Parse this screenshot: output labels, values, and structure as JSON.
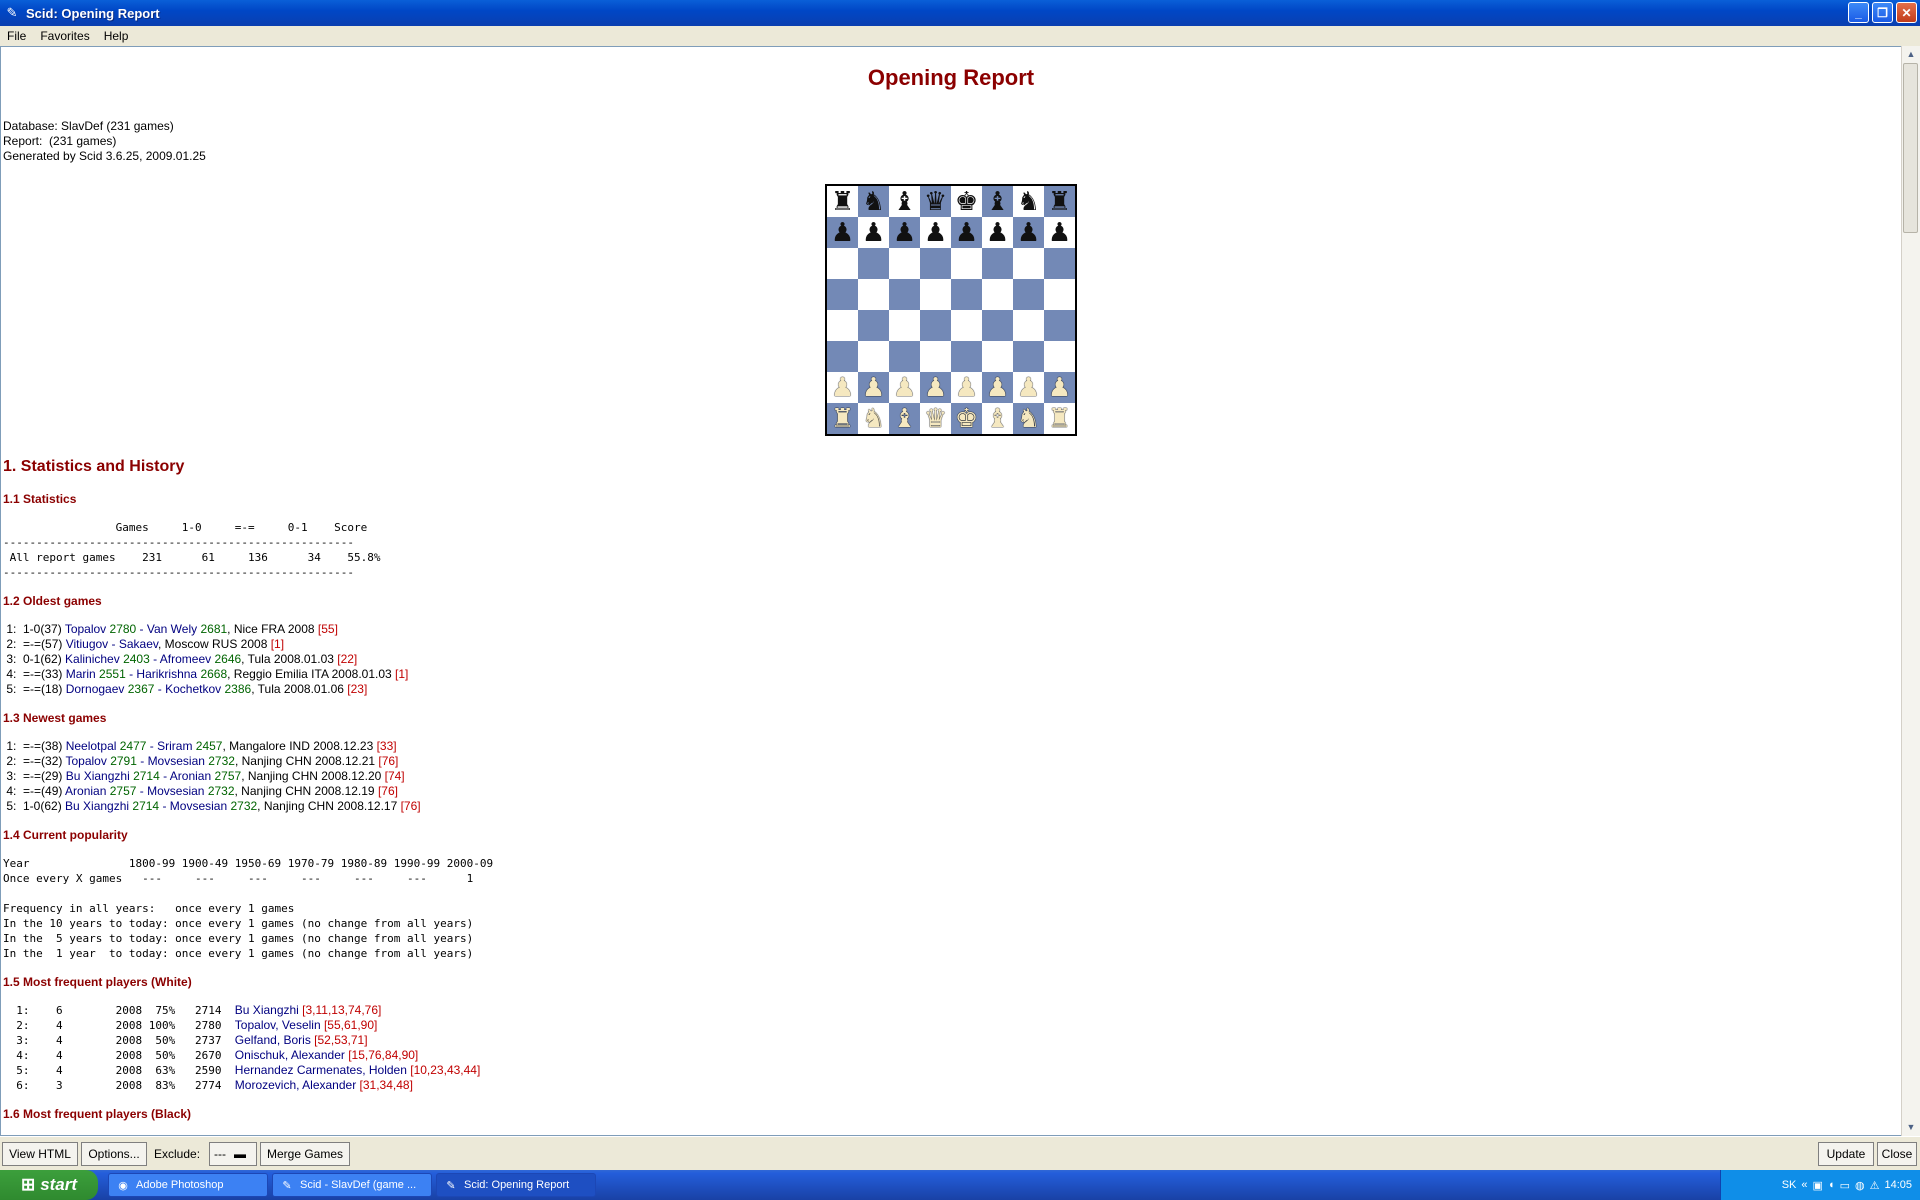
{
  "window": {
    "title": "Scid: Opening Report"
  },
  "menu": [
    "File",
    "Favorites",
    "Help"
  ],
  "report": {
    "title": "Opening Report",
    "meta": [
      "Database: SlavDef (231 games)",
      "Report:  (231 games)",
      "Generated by Scid 3.6.25, 2009.01.25"
    ],
    "board": [
      "rnbqkbnr",
      "pppppppp",
      "........",
      "........",
      "........",
      "........",
      "PPPPPPPP",
      "RNBQKBNR"
    ],
    "section1": "1. Statistics and History",
    "s11": {
      "heading": "1.1 Statistics",
      "table": "                 Games     1-0     =-=     0-1    Score\n-----------------------------------------------------\n All report games    231      61     136      34    55.8%\n-----------------------------------------------------"
    },
    "s12": {
      "heading": "1.2 Oldest games",
      "rows": [
        {
          "pre": " 1:  1-0(37) ",
          "w": "Topalov",
          "we": " 2780",
          "sep": " - ",
          "b": "Van Wely",
          "be": " 2681",
          "post": ", Nice FRA 2008 ",
          "ref": "[55]"
        },
        {
          "pre": " 2:  =-=(57) ",
          "w": "Vitiugov",
          "we": "",
          "sep": " - ",
          "b": "Sakaev",
          "be": "",
          "post": ", Moscow RUS 2008 ",
          "ref": "[1]"
        },
        {
          "pre": " 3:  0-1(62) ",
          "w": "Kalinichev",
          "we": " 2403",
          "sep": " - ",
          "b": "Afromeev",
          "be": " 2646",
          "post": ", Tula 2008.01.03 ",
          "ref": "[22]"
        },
        {
          "pre": " 4:  =-=(33) ",
          "w": "Marin",
          "we": " 2551",
          "sep": " - ",
          "b": "Harikrishna",
          "be": " 2668",
          "post": ", Reggio Emilia ITA 2008.01.03 ",
          "ref": "[1]"
        },
        {
          "pre": " 5:  =-=(18) ",
          "w": "Dornogaev",
          "we": " 2367",
          "sep": " - ",
          "b": "Kochetkov",
          "be": " 2386",
          "post": ", Tula 2008.01.06 ",
          "ref": "[23]"
        }
      ]
    },
    "s13": {
      "heading": "1.3 Newest games",
      "rows": [
        {
          "pre": " 1:  =-=(38) ",
          "w": "Neelotpal",
          "we": " 2477",
          "sep": " - ",
          "b": "Sriram",
          "be": " 2457",
          "post": ", Mangalore IND 2008.12.23 ",
          "ref": "[33]"
        },
        {
          "pre": " 2:  =-=(32) ",
          "w": "Topalov",
          "we": " 2791",
          "sep": " - ",
          "b": "Movsesian",
          "be": " 2732",
          "post": ", Nanjing CHN 2008.12.21 ",
          "ref": "[76]"
        },
        {
          "pre": " 3:  =-=(29) ",
          "w": "Bu Xiangzhi",
          "we": " 2714",
          "sep": " - ",
          "b": "Aronian",
          "be": " 2757",
          "post": ", Nanjing CHN 2008.12.20 ",
          "ref": "[74]"
        },
        {
          "pre": " 4:  =-=(49) ",
          "w": "Aronian",
          "we": " 2757",
          "sep": " - ",
          "b": "Movsesian",
          "be": " 2732",
          "post": ", Nanjing CHN 2008.12.19 ",
          "ref": "[76]"
        },
        {
          "pre": " 5:  1-0(62) ",
          "w": "Bu Xiangzhi",
          "we": " 2714",
          "sep": " - ",
          "b": "Movsesian",
          "be": " 2732",
          "post": ", Nanjing CHN 2008.12.17 ",
          "ref": "[76]"
        }
      ]
    },
    "s14": {
      "heading": "1.4 Current popularity",
      "table": "Year               1800-99 1900-49 1950-69 1970-79 1980-89 1990-99 2000-09\nOnce every X games   ---     ---     ---     ---     ---     ---      1",
      "freq": "Frequency in all years:   once every 1 games\nIn the 10 years to today: once every 1 games (no change from all years)\nIn the  5 years to today: once every 1 games (no change from all years)\nIn the  1 year  to today: once every 1 games (no change from all years)"
    },
    "s15": {
      "heading": "1.5 Most frequent players (White)",
      "rows": [
        {
          "stats": "  1:    6        2008  75%   2714  ",
          "name": "Bu Xiangzhi",
          "ref": " [3,11,13,74,76]"
        },
        {
          "stats": "  2:    4        2008 100%   2780  ",
          "name": "Topalov, Veselin",
          "ref": " [55,61,90]"
        },
        {
          "stats": "  3:    4        2008  50%   2737  ",
          "name": "Gelfand, Boris",
          "ref": " [52,53,71]"
        },
        {
          "stats": "  4:    4        2008  50%   2670  ",
          "name": "Onischuk, Alexander",
          "ref": " [15,76,84,90]"
        },
        {
          "stats": "  5:    4        2008  63%   2590  ",
          "name": "Hernandez Carmenates, Holden",
          "ref": " [10,23,43,44]"
        },
        {
          "stats": "  6:    3        2008  83%   2774  ",
          "name": "Morozevich, Alexander",
          "ref": " [31,34,48]"
        }
      ]
    },
    "s16": {
      "heading": "1.6 Most frequent players (Black)"
    }
  },
  "bottombar": {
    "view_html": "View HTML",
    "options": "Options...",
    "exclude_label": "Exclude:",
    "exclude_value": "---",
    "merge_games": "Merge Games",
    "update": "Update",
    "close": "Close"
  },
  "taskbar": {
    "start": "start",
    "tasks": [
      "Adobe Photoshop",
      "Scid - SlavDef (game ...",
      "Scid: Opening Report"
    ],
    "lang": "SK",
    "clock": "14:05"
  }
}
